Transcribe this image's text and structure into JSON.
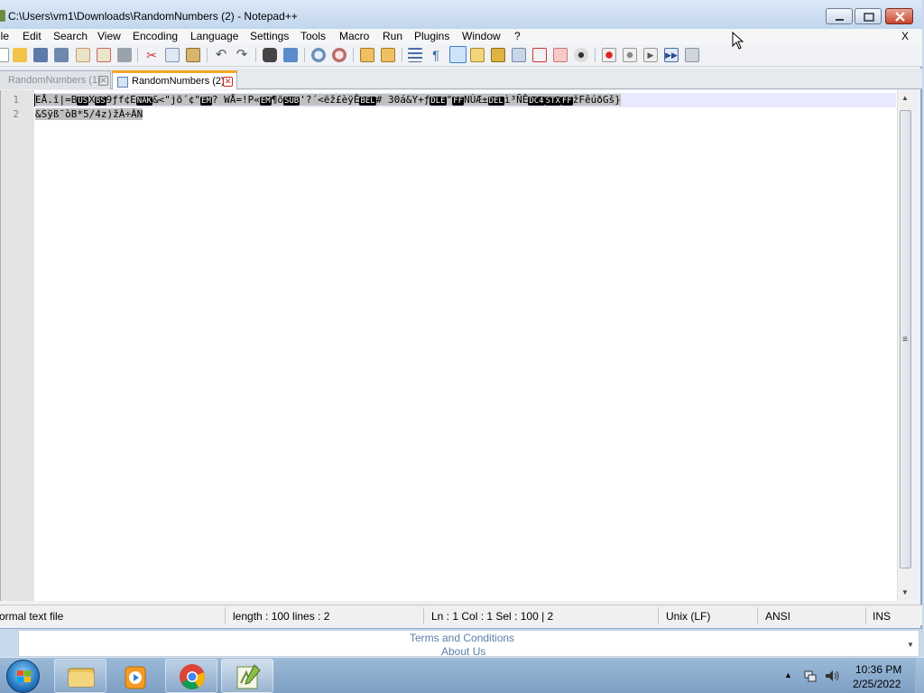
{
  "window": {
    "title": "C:\\Users\\vm1\\Downloads\\RandomNumbers (2) - Notepad++"
  },
  "menu": {
    "items": [
      "ile",
      "Edit",
      "Search",
      "View",
      "Encoding",
      "Language",
      "Settings",
      "Tools",
      "Macro",
      "Run",
      "Plugins",
      "Window",
      "?"
    ],
    "close_doc": "X"
  },
  "toolbar": {
    "icons": [
      "new-file-icon",
      "open-file-icon",
      "save-icon",
      "save-all-icon",
      "close-icon",
      "close-all-icon",
      "print-icon",
      "cut-icon",
      "copy-icon",
      "paste-icon",
      "undo-icon",
      "redo-icon",
      "find-icon",
      "replace-icon",
      "zoom-in-icon",
      "zoom-out-icon",
      "sync-vertical-icon",
      "sync-horizontal-icon",
      "word-wrap-icon",
      "show-all-chars-icon",
      "indent-guide-icon",
      "doc-map-icon",
      "function-list-icon",
      "folder-as-workspace-icon",
      "doc-list-icon",
      "monitoring-icon",
      "record-macro-icon",
      "stop-record-icon",
      "playback-icon",
      "run-macro-multiple-icon",
      "save-macro-icon"
    ]
  },
  "tabs": [
    {
      "label": "RandomNumbers (1)",
      "active": false
    },
    {
      "label": "RandomNumbers (2)",
      "active": true
    }
  ],
  "editor": {
    "line_numbers": [
      "1",
      "2"
    ],
    "line1_parts": [
      {
        "t": "EÅ.î|=B",
        "ctl": false
      },
      {
        "t": "US",
        "ctl": true
      },
      {
        "t": "X",
        "ctl": false
      },
      {
        "t": "BS",
        "ctl": true
      },
      {
        "t": "9ƒf¢E",
        "ctl": false
      },
      {
        "t": "NAK",
        "ctl": true
      },
      {
        "t": "&<\"jõ´¢\"",
        "ctl": false
      },
      {
        "t": "EM",
        "ctl": true
      },
      {
        "t": "? WÅ=!P«",
        "ctl": false
      },
      {
        "t": "EM",
        "ctl": true
      },
      {
        "t": "¶õ",
        "ctl": false
      },
      {
        "t": "SUB",
        "ctl": true
      },
      {
        "t": "'?´<ëž£èÿÊ",
        "ctl": false
      },
      {
        "t": "BEL",
        "ctl": true
      },
      {
        "t": "# 30á&Y+ƒ",
        "ctl": false
      },
      {
        "t": "DLE",
        "ctl": true
      },
      {
        "t": "\"",
        "ctl": false
      },
      {
        "t": "FF",
        "ctl": true
      },
      {
        "t": "NÚÆ±",
        "ctl": false
      },
      {
        "t": "DEL",
        "ctl": true
      },
      {
        "t": "ì³ÑÊ",
        "ctl": false
      },
      {
        "t": "DC4",
        "ctl": true
      },
      {
        "t": "STX",
        "ctl": true
      },
      {
        "t": "FF",
        "ctl": true
      },
      {
        "t": "žFêúðGš}",
        "ctl": false
      }
    ],
    "line2": "&Sÿß¯òB*5/4z)žÀ÷ÀN"
  },
  "status": {
    "file_type": "ormal text file",
    "length_lines": "length : 100    lines : 2",
    "position": "Ln : 1    Col : 1    Sel : 100 | 2",
    "eol": "Unix (LF)",
    "encoding": "ANSI",
    "mode": "INS"
  },
  "browser_footer": {
    "terms": "Terms and Conditions",
    "about": "About Us"
  },
  "taskbar": {
    "apps": [
      "file-explorer-icon",
      "media-player-icon",
      "chrome-icon",
      "notepadpp-icon"
    ],
    "time": "10:36 PM",
    "date": "2/25/2022"
  },
  "colors": {
    "active_tab_accent": "#f5a623",
    "current_line": "#e8e8ff",
    "selection": "#c0c0c0",
    "close_button": "#c8452f"
  }
}
